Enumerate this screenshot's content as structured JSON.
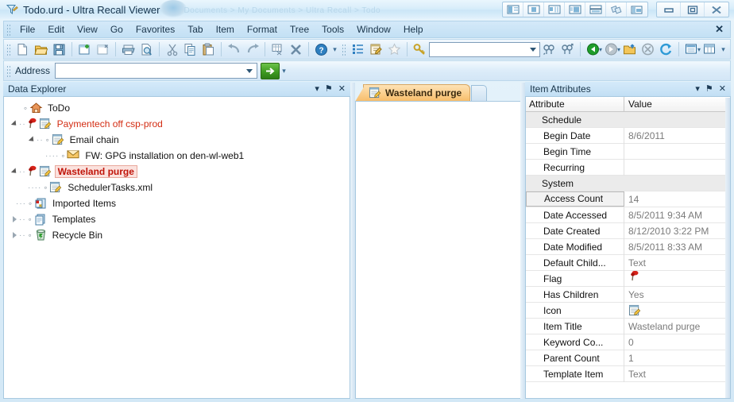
{
  "window": {
    "title": "Todo.urd - Ultra Recall Viewer",
    "app_icon": "ultrarecall-icon",
    "ghost_breadcrumb": "Documents  >  My Documents  >  Ultra Recall  >  Todo",
    "layout_buttons": [
      "layout-left-pane-toggle",
      "layout-center-pane-toggle",
      "layout-right-pane-toggle",
      "layout-split-toggle",
      "layout-horizontal-split-toggle",
      "layout-float-toggle",
      "layout-restore-panes-toggle"
    ],
    "controls": {
      "minimize": "minimize-button",
      "restore": "restore-button",
      "close": "close-button"
    }
  },
  "menubar": {
    "items": [
      {
        "label": "File"
      },
      {
        "label": "Edit"
      },
      {
        "label": "View"
      },
      {
        "label": "Go"
      },
      {
        "label": "Favorites"
      },
      {
        "label": "Tab"
      },
      {
        "label": "Item"
      },
      {
        "label": "Format"
      },
      {
        "label": "Tree"
      },
      {
        "label": "Tools"
      },
      {
        "label": "Window"
      },
      {
        "label": "Help"
      }
    ],
    "close_label": "✕"
  },
  "toolbar": {
    "buttons": [
      "new-document-icon",
      "open-folder-icon",
      "save-icon",
      "new-item-icon",
      "close-item-icon",
      "print-icon",
      "print-preview-icon",
      "cut-icon",
      "copy-icon",
      "paste-icon",
      "undo-icon",
      "redo-icon",
      "insert-table-icon",
      "delete-icon",
      "help-icon"
    ],
    "right_buttons": [
      "outline-view-icon",
      "edit-note-icon",
      "favorite-star-icon",
      "keyword-key-icon"
    ],
    "search_value": "",
    "after_search_buttons": [
      "find-previous-icon",
      "find-next-icon",
      "back-icon",
      "back-dropdown-icon",
      "forward-icon",
      "forward-dropdown-icon",
      "open-parent-icon",
      "stop-icon",
      "refresh-icon",
      "pane-layout-icon",
      "pane-layout-dropdown-icon",
      "grid-view-icon"
    ],
    "overflow_label": "▾"
  },
  "address": {
    "label": "Address",
    "value": "",
    "placeholder": "",
    "go_label": "→",
    "go_icon": "go-arrow-icon",
    "overflow_label": "▾"
  },
  "data_explorer": {
    "title": "Data Explorer",
    "tools": {
      "menu": "▾",
      "pin": "⚑",
      "close": "✕"
    },
    "tree": [
      {
        "label": "ToDo",
        "icon": "home-icon",
        "depth": 0,
        "expander": "none",
        "flag": false,
        "style": "normal"
      },
      {
        "label": "Paymentech off csp-prod",
        "icon": "note-icon",
        "depth": 0,
        "expander": "open",
        "flag": true,
        "style": "red"
      },
      {
        "label": "Email chain",
        "icon": "note-icon",
        "depth": 1,
        "expander": "open",
        "flag": false,
        "style": "normal"
      },
      {
        "label": "FW: GPG installation on den-wl-web1",
        "icon": "envelope-icon",
        "depth": 2,
        "expander": "none",
        "flag": false,
        "style": "normal"
      },
      {
        "label": "Wasteland purge",
        "icon": "note-icon",
        "depth": 0,
        "expander": "open",
        "flag": true,
        "style": "selected"
      },
      {
        "label": "SchedulerTasks.xml",
        "icon": "note-icon",
        "depth": 1,
        "expander": "none",
        "flag": false,
        "style": "normal"
      },
      {
        "label": "Imported Items",
        "icon": "imported-items-icon",
        "depth": 0,
        "expander": "none",
        "flag": false,
        "style": "normal"
      },
      {
        "label": "Templates",
        "icon": "templates-icon",
        "depth": 0,
        "expander": "closed",
        "flag": false,
        "style": "normal"
      },
      {
        "label": "Recycle Bin",
        "icon": "recycle-bin-icon",
        "depth": 0,
        "expander": "closed",
        "flag": false,
        "style": "normal"
      }
    ]
  },
  "center": {
    "tabs": [
      {
        "label": "Wasteland purge",
        "icon": "note-icon",
        "active": true
      }
    ],
    "content": ""
  },
  "item_attributes": {
    "title": "Item Attributes",
    "tools": {
      "menu": "▾",
      "pin": "⚑",
      "close": "✕"
    },
    "columns": {
      "attribute": "Attribute",
      "value": "Value"
    },
    "rows": [
      {
        "attr": "Schedule",
        "value": "",
        "group": true
      },
      {
        "attr": "Begin Date",
        "value": "8/6/2011",
        "group": false
      },
      {
        "attr": "Begin Time",
        "value": "",
        "group": false
      },
      {
        "attr": "Recurring",
        "value": "",
        "group": false
      },
      {
        "attr": "System",
        "value": "",
        "group": true
      },
      {
        "attr": "Access Count",
        "value": "14",
        "group": false,
        "selected": true
      },
      {
        "attr": "Date Accessed",
        "value": "8/5/2011 9:34 AM",
        "group": false
      },
      {
        "attr": "Date Created",
        "value": "8/12/2010 3:22 PM",
        "group": false
      },
      {
        "attr": "Date Modified",
        "value": "8/5/2011 8:33 AM",
        "group": false
      },
      {
        "attr": "Default Child...",
        "value": "Text",
        "group": false
      },
      {
        "attr": "Flag",
        "value": "",
        "group": false,
        "value_icon": "flag-icon"
      },
      {
        "attr": "Has Children",
        "value": "Yes",
        "group": false
      },
      {
        "attr": "Icon",
        "value": "",
        "group": false,
        "value_icon": "note-icon"
      },
      {
        "attr": "Item Title",
        "value": "Wasteland purge",
        "group": false
      },
      {
        "attr": "Keyword Co...",
        "value": "0",
        "group": false
      },
      {
        "attr": "Parent Count",
        "value": "1",
        "group": false
      },
      {
        "attr": "Template Item",
        "value": "Text",
        "group": false
      }
    ]
  },
  "colors": {
    "titlebar_top": "#eaf6fd",
    "titlebar_bottom": "#e3f2fc",
    "menubar": "#c9e2f5",
    "panel_header": "#c9e2f5",
    "tab_active": "#f7bd6a",
    "tree_red": "#d32d13",
    "tree_selected_text": "#c0150a",
    "tree_selected_bg": "#fbe2de",
    "grid_group_bg": "#ebebeb",
    "grid_value_text": "#7a7a7a",
    "go_button": "#3f9b22"
  }
}
